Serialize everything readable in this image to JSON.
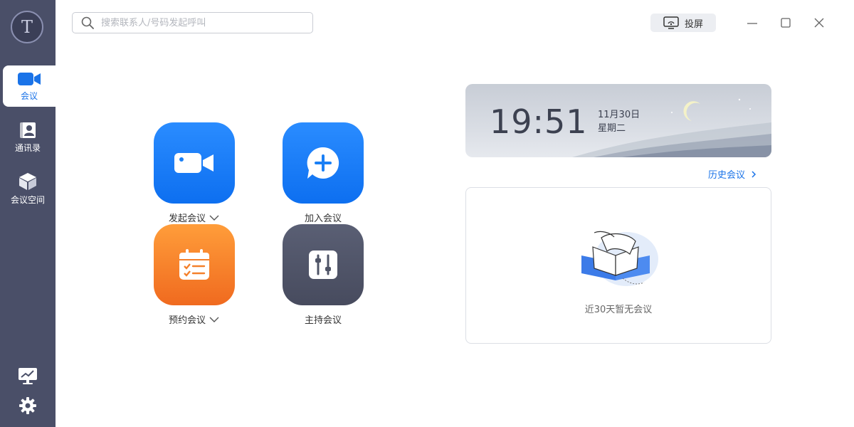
{
  "sidebar": {
    "avatar_letter": "T",
    "items": [
      {
        "label": "会议",
        "icon": "video-camera-icon",
        "active": true
      },
      {
        "label": "通讯录",
        "icon": "contacts-icon",
        "active": false
      },
      {
        "label": "会议空间",
        "icon": "cube-icon",
        "active": false
      }
    ],
    "bottom_icons": [
      "monitor-chart-icon",
      "gear-icon"
    ]
  },
  "header": {
    "search_placeholder": "搜索联系人/号码发起呼叫",
    "cast_label": "投屏"
  },
  "actions": [
    {
      "label": "发起会议",
      "icon": "video-camera-icon",
      "color": "#1a7ff5",
      "has_dropdown": true
    },
    {
      "label": "加入会议",
      "icon": "plus-bubble-icon",
      "color": "#1a7ff5",
      "has_dropdown": false
    },
    {
      "label": "预约会议",
      "icon": "calendar-icon",
      "color": "#f4802b",
      "has_dropdown": true
    },
    {
      "label": "主持会议",
      "icon": "sliders-icon",
      "color": "#4f5467",
      "has_dropdown": false
    }
  ],
  "clock": {
    "time": "19:51",
    "date": "11月30日",
    "weekday": "星期二"
  },
  "history": {
    "link_label": "历史会议",
    "empty_text": "近30天暂无会议"
  },
  "colors": {
    "accent": "#1a73e8",
    "sidebar": "#4a4f68"
  }
}
